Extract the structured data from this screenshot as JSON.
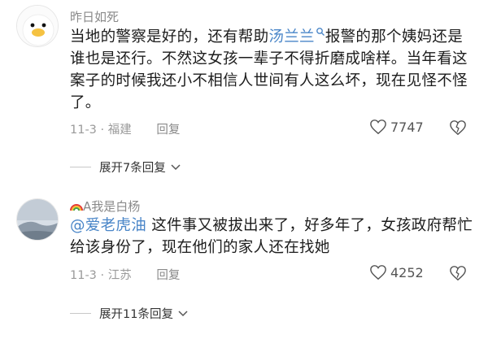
{
  "comments": [
    {
      "username": "昨日如死",
      "text_before": "当地的警察是好的，还有帮助",
      "link": "汤兰兰",
      "text_after": "报警的那个姨妈还是谁也是还行。不然这女孩一辈子不得折磨成啥样。当年看这案子的时候我还小不相信人世间有人这么坏，现在见怪不怪了。",
      "date_location": "11-3 · 福建",
      "reply_label": "回复",
      "likes": "7747",
      "expand_label": "展开7条回复"
    },
    {
      "username_prefix": "A",
      "username": "我是白杨",
      "mention": "@爱老虎油",
      "text": " 这件事又被拔出来了，好多年了，女孩政府帮忙给该身份了，现在他们的家人还在找她",
      "date_location": "11-3 · 江苏",
      "reply_label": "回复",
      "likes": "4252",
      "expand_label": "展开11条回复"
    }
  ],
  "icons": {
    "search": "search-icon",
    "heart": "heart-icon",
    "broken_heart": "broken-heart-icon",
    "chevron": "chevron-down-icon",
    "rainbow": "rainbow-icon"
  }
}
